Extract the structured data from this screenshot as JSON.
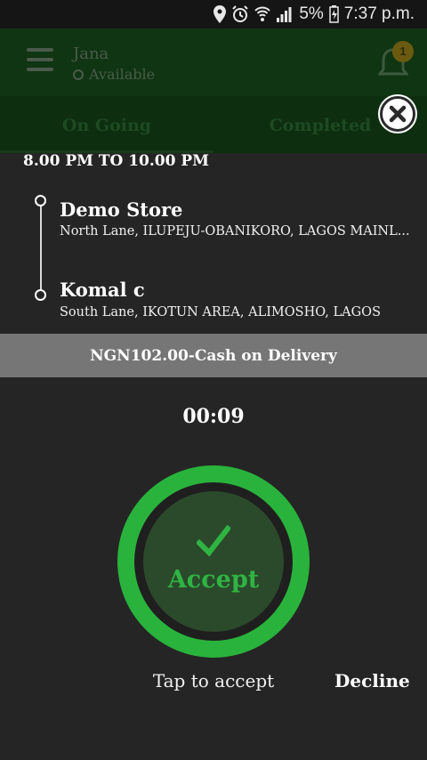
{
  "status_bar": {
    "battery_percent": "5%",
    "time": "7:37 p.m."
  },
  "background_app": {
    "user_name": "Jana",
    "availability": "Available",
    "notification_count": "1",
    "tabs": [
      {
        "label": "On Going",
        "active": true
      },
      {
        "label": "Completed",
        "active": false
      }
    ]
  },
  "order": {
    "time_window": "8.00 PM TO 10.00 PM",
    "pickup": {
      "name": "Demo Store",
      "address": "North Lane, ILUPEJU-OBANIKORO, LAGOS MAINL..."
    },
    "dropoff": {
      "name": "Komal c",
      "address": "South Lane, IKOTUN AREA, ALIMOSHO, LAGOS"
    },
    "payment": "NGN102.00-Cash on Delivery",
    "timer": "00:09"
  },
  "actions": {
    "accept_label": "Accept",
    "tap_hint": "Tap to accept",
    "decline_label": "Decline"
  },
  "colors": {
    "accept_green": "#29b33c",
    "app_bar_dimmed": "#0f3512",
    "payment_bar": "#767676",
    "background": "#252525"
  }
}
